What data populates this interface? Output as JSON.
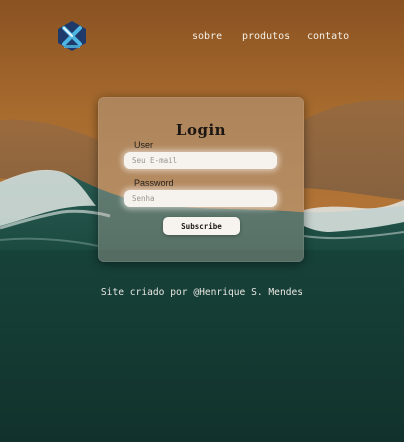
{
  "nav": {
    "items": [
      "sobre",
      "produtos",
      "contato"
    ]
  },
  "login": {
    "title": "Login",
    "user_label": "User",
    "user_placeholder": "Seu E-mail",
    "password_label": "Password",
    "password_placeholder": "Senha",
    "submit_label": "Subscribe"
  },
  "footer": {
    "credit": "Site criado por @Henrique S. Mendes"
  },
  "colors": {
    "sand": "#a66a2c",
    "ocean": "#163a33",
    "foam": "#e8ece9"
  },
  "icons": {
    "logo": "x-shield-logo-icon"
  }
}
